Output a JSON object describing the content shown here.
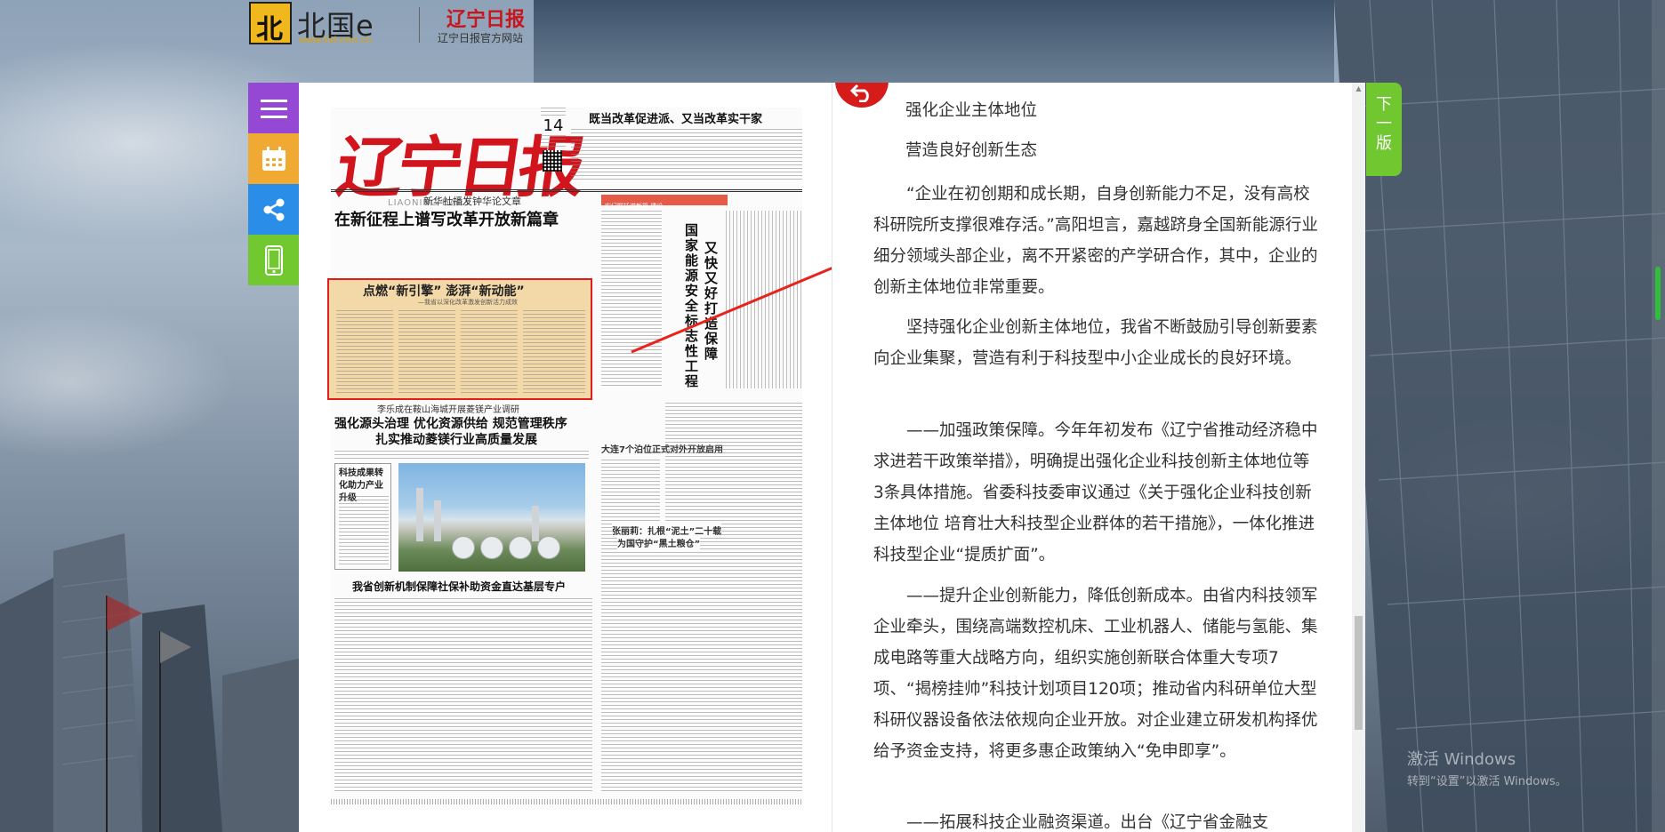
{
  "header": {
    "logo_mark": "北",
    "logo_name": "北国e",
    "logo_url": "www.lnd.com.cn",
    "paper_name": "辽宁日报",
    "paper_sub": "辽宁日报官方网站"
  },
  "tools": [
    {
      "name": "menu-icon"
    },
    {
      "name": "calendar-icon"
    },
    {
      "name": "share-icon"
    },
    {
      "name": "mobile-icon"
    }
  ],
  "newspaper": {
    "masthead": "辽宁日报",
    "masthead_en": "LIAONING DAILY",
    "date_num": "14",
    "top_headline": "既当改革促进派、又当改革实干家",
    "lead_sub": "新华社播发钟华论文章",
    "lead_title": "在新征程上谱写改革开放新篇章",
    "highlight_title": "点燃“新引擎” 澎湃“新动能”",
    "highlight_sub": "—我省以深化改革激发创新活力成效",
    "redbar_text": "牢记嘱托谱新篇 建设",
    "vertical_title_1": "又快又好打造保障",
    "vertical_title_2": "国家能源安全标志性工程",
    "sec2_sub": "李乐成在鞍山海城开展菱镁产业调研",
    "sec2_title_1": "强化源头治理 优化资源供给 规范管理秩序",
    "sec2_title_2": "扎实推动菱镁行业高质量发展",
    "right_sub": "大连7个泊位正式对外开放启用",
    "box_title": "科技成果转化助力产业升级",
    "right_sub2": "张丽莉：扎根“泥土”二十载",
    "right_sub3": "为国守护“黑土粮仓”",
    "bottom_title": "我省创新机制保障社保补助资金直达基层专户"
  },
  "reader": {
    "back_label": "返回",
    "paragraphs": [
      "强化企业主体地位",
      "营造良好创新生态",
      "“企业在初创期和成长期，自身创新能力不足，没有高校科研院所支撑很难存活。”高阳坦言，嘉越跻身全国新能源行业细分领域头部企业，离不开紧密的产学研合作，其中，企业的创新主体地位非常重要。",
      "坚持强化企业创新主体地位，我省不断鼓励引导创新要素向企业集聚，营造有利于科技型中小企业成长的良好环境。",
      "——加强政策保障。今年年初发布《辽宁省推动经济稳中求进若干政策举措》，明确提出强化企业科技创新主体地位等3条具体措施。省委科技委审议通过《关于强化企业科技创新主体地位 培育壮大科技型企业群体的若干措施》，一体化推进科技型企业“提质扩面”。",
      "——提升企业创新能力，降低创新成本。由省内科技领军企业牵头，围绕高端数控机床、工业机器人、储能与氢能、集成电路等重大战略方向，组织实施创新联合体重大专项7项、“揭榜挂帅”科技计划项目120项；推动省内科研单位大型科研仪器设备依法依规向企业开放。对企业建立研发机构择优给予资金支持，将更多惠企政策纳入“免申即享”。",
      "——拓展科技企业融资渠道。出台《辽宁省金融支"
    ]
  },
  "next_edition": [
    "下",
    "一",
    "版"
  ],
  "watermark": {
    "line1": "激活 Windows",
    "line2": "转到“设置”以激活 Windows。"
  },
  "colors": {
    "menu": "#9448d3",
    "calendar": "#f0a933",
    "share": "#2a8ee8",
    "mobile": "#71c82f",
    "next": "#70c72f",
    "accent_red": "#d61b1b"
  }
}
